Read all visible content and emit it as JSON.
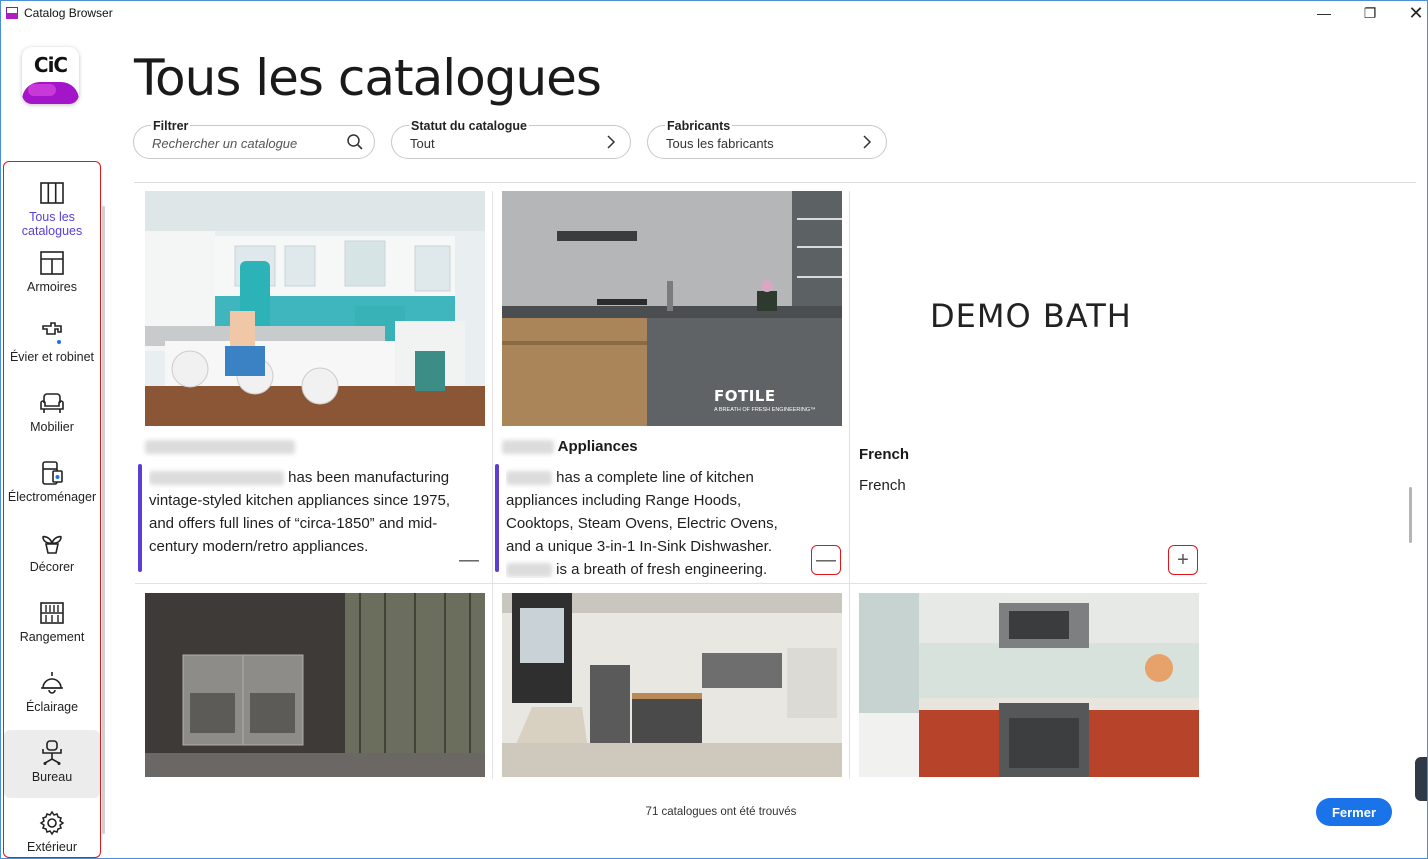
{
  "window": {
    "title": "Catalog Browser",
    "minimize": "—",
    "maximize": "❐",
    "close": "✕"
  },
  "logo": {
    "text": "CiC"
  },
  "nav": {
    "items": [
      {
        "label": "Tous les\ncatalogues",
        "icon": "book-open-icon"
      },
      {
        "label": "Armoires",
        "icon": "cabinet-icon"
      },
      {
        "label": "Évier et robinet",
        "icon": "faucet-icon"
      },
      {
        "label": "Mobilier",
        "icon": "armchair-icon"
      },
      {
        "label": "Électroménager",
        "icon": "appliance-icon"
      },
      {
        "label": "Décorer",
        "icon": "plant-icon"
      },
      {
        "label": "Rangement",
        "icon": "shelving-icon"
      },
      {
        "label": "Éclairage",
        "icon": "lamp-icon"
      },
      {
        "label": "Bureau",
        "icon": "office-chair-icon"
      },
      {
        "label": "Extérieur",
        "icon": "gear-icon"
      }
    ]
  },
  "page": {
    "title": "Tous les catalogues"
  },
  "filters": {
    "search": {
      "label": "Filtrer",
      "placeholder": "Rechercher un catalogue"
    },
    "status": {
      "label": "Statut du catalogue",
      "value": "Tout"
    },
    "manufacturers": {
      "label": "Fabricants",
      "value": "Tous les fabricants"
    }
  },
  "cards": [
    {
      "title_suffix": "",
      "desc_lead": "has been",
      "desc_rest": "manufacturing vintage-styled kitchen appliances since 1975, and offers full lines of “circa-1850” and mid-century modern/retro appliances.",
      "toggle": "—"
    },
    {
      "title_suffix": "Appliances",
      "desc_lead": "has a complete line of kitchen",
      "desc_rest": "appliances including Range Hoods, Cooktops, Steam Ovens, Electric Ovens, and a unique 3-in-1 In-Sink Dishwasher.",
      "desc_tail": "is a breath of fresh engineering.",
      "image_brand": "FOTILE",
      "image_tagline": "A BREATH OF FRESH ENGINEERING™",
      "toggle": "—"
    },
    {
      "image_text": "DEMO BATH",
      "title": "French",
      "desc": "French",
      "toggle": "+"
    }
  ],
  "footer": {
    "count_text": "71 catalogues ont été trouvés",
    "close_label": "Fermer"
  },
  "colors": {
    "accent": "#5b3fd3",
    "primary_button": "#1a73e8",
    "highlight_outline": "#e0161a"
  }
}
